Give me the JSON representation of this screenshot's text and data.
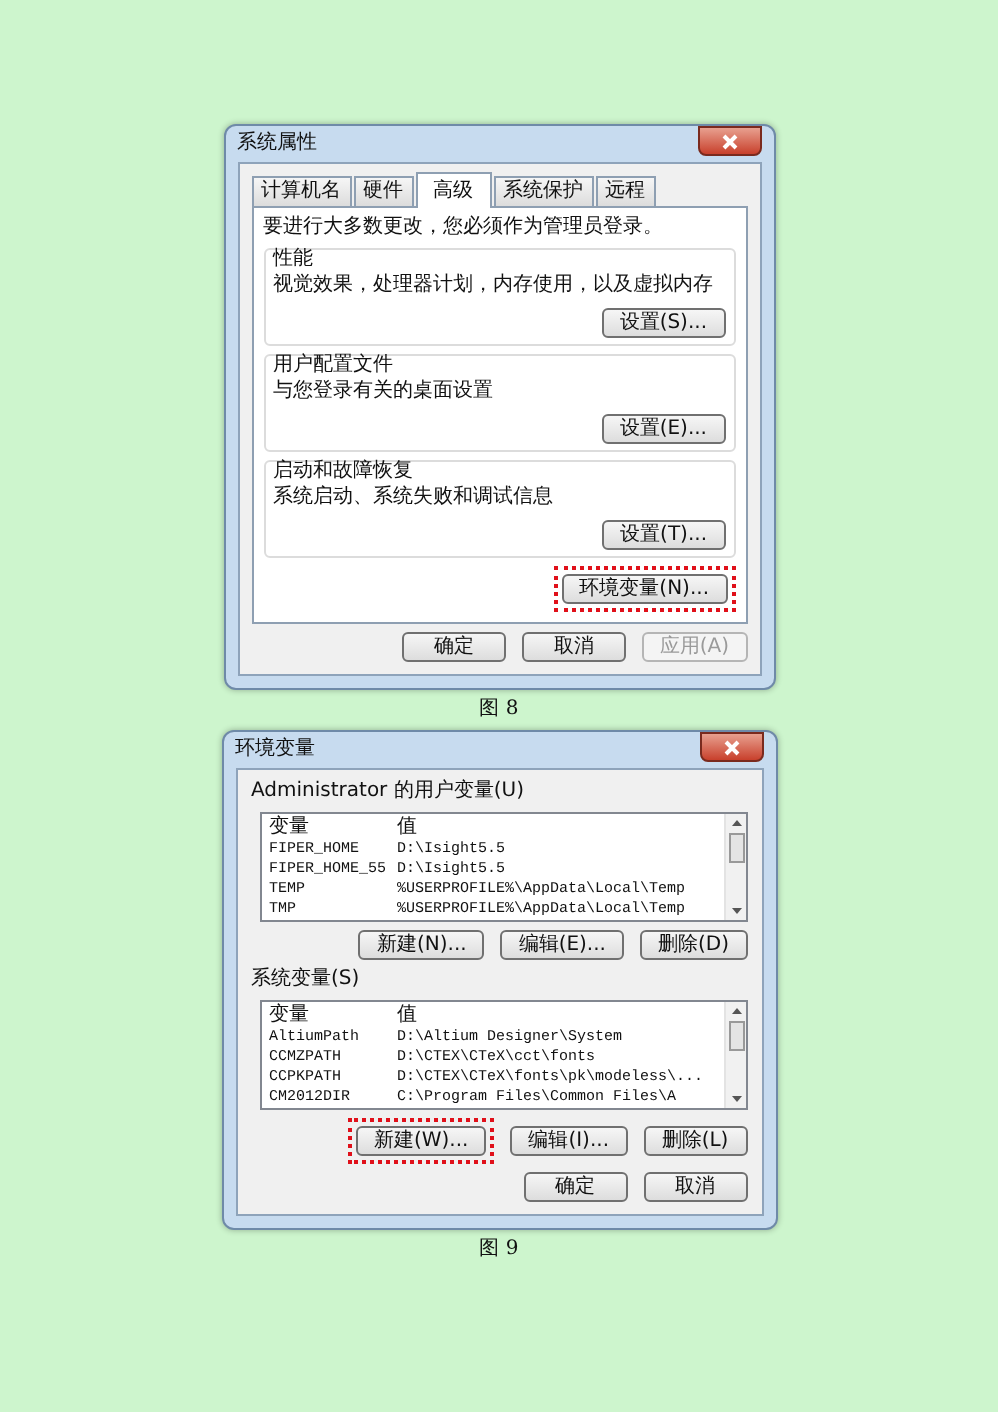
{
  "figure_8": {
    "dialog": {
      "title": "系统属性",
      "tabs": [
        {
          "label": "计算机名",
          "selected": false
        },
        {
          "label": "硬件",
          "selected": false
        },
        {
          "label": "高级",
          "selected": true
        },
        {
          "label": "系统保护",
          "selected": false
        },
        {
          "label": "远程",
          "selected": false
        }
      ],
      "notice": "要进行大多数更改，您必须作为管理员登录。",
      "groups": [
        {
          "title": "性能",
          "description": "视觉效果，处理器计划，内存使用，以及虚拟内存",
          "button": "设置(S)..."
        },
        {
          "title": "用户配置文件",
          "description": "与您登录有关的桌面设置",
          "button": "设置(E)..."
        },
        {
          "title": "启动和故障恢复",
          "description": "系统启动、系统失败和调试信息",
          "button": "设置(T)..."
        }
      ],
      "env_button": {
        "label": "环境变量(N)...",
        "highlighted": true
      },
      "footer_buttons": [
        {
          "label": "确定",
          "disabled": false
        },
        {
          "label": "取消",
          "disabled": false
        },
        {
          "label": "应用(A)",
          "disabled": true
        }
      ]
    },
    "caption": "图 8"
  },
  "figure_9": {
    "dialog": {
      "title": "环境变量",
      "sections": [
        {
          "label": "Administrator 的用户变量(U)",
          "columns": [
            "变量",
            "值"
          ],
          "rows": [
            {
              "name": "FIPER_HOME",
              "value": "D:\\Isight5.5"
            },
            {
              "name": "FIPER_HOME_55",
              "value": "D:\\Isight5.5"
            },
            {
              "name": "TEMP",
              "value": "%USERPROFILE%\\AppData\\Local\\Temp"
            },
            {
              "name": "TMP",
              "value": "%USERPROFILE%\\AppData\\Local\\Temp"
            }
          ],
          "buttons": [
            {
              "label": "新建(N)...",
              "highlighted": false
            },
            {
              "label": "编辑(E)...",
              "highlighted": false
            },
            {
              "label": "删除(D)",
              "highlighted": false
            }
          ]
        },
        {
          "label": "系统变量(S)",
          "columns": [
            "变量",
            "值"
          ],
          "rows": [
            {
              "name": "AltiumPath",
              "value": "D:\\Altium Designer\\System"
            },
            {
              "name": "CCMZPATH",
              "value": "D:\\CTEX\\CTeX\\cct\\fonts"
            },
            {
              "name": "CCPKPATH",
              "value": "D:\\CTEX\\CTeX\\fonts\\pk\\modeless\\..."
            },
            {
              "name": "CM2012DIR",
              "value": "C:\\Program Files\\Common Files\\A"
            }
          ],
          "buttons": [
            {
              "label": "新建(W)...",
              "highlighted": true
            },
            {
              "label": "编辑(I)...",
              "highlighted": false
            },
            {
              "label": "删除(L)",
              "highlighted": false
            }
          ]
        }
      ],
      "footer_buttons": [
        {
          "label": "确定",
          "disabled": false
        },
        {
          "label": "取消",
          "disabled": false
        }
      ]
    },
    "caption": "图 9"
  }
}
